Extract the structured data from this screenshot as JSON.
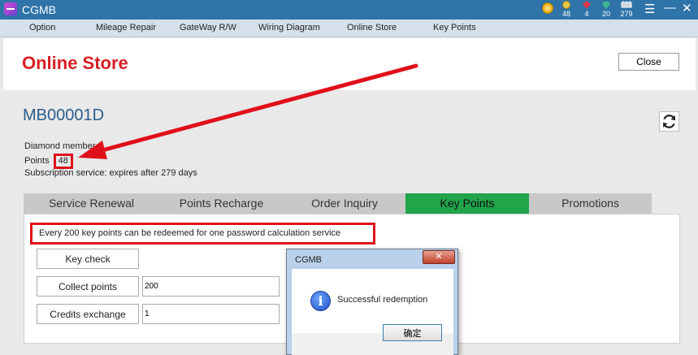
{
  "app": {
    "title": "CGMB"
  },
  "titlebar": {
    "stats": [
      {
        "icon": "gold-coin-icon",
        "color": "#f2b51a",
        "value": ""
      },
      {
        "icon": "coin-icon",
        "color": "#e8c64a",
        "value": "48"
      },
      {
        "icon": "ruby-icon",
        "color": "#e0334a",
        "value": "4"
      },
      {
        "icon": "emerald-icon",
        "color": "#3fb48a",
        "value": "20"
      },
      {
        "icon": "chip-icon",
        "color": "#cfd6de",
        "value": "279"
      }
    ]
  },
  "menu": {
    "items": [
      "Option",
      "Mileage Repair",
      "GateWay R/W",
      "Wiring Diagram",
      "Online Store",
      "Key Points"
    ]
  },
  "header": {
    "title": "Online Store",
    "close_label": "Close"
  },
  "account": {
    "id": "MB00001D",
    "member": "Diamond member",
    "points_label": "Points",
    "points": "48",
    "subscription": "Subscription service: expires after 279 days"
  },
  "tabs": [
    {
      "label": "Service Renewal",
      "active": false
    },
    {
      "label": "Points Recharge",
      "active": false
    },
    {
      "label": "Order Inquiry",
      "active": false
    },
    {
      "label": "Key Points",
      "active": true
    },
    {
      "label": "Promotions",
      "active": false
    }
  ],
  "keypoints": {
    "notice": "Every 200 key points can be redeemed for one password calculation service",
    "key_check": "Key check",
    "collect_points": "Collect points",
    "collect_value": "200",
    "credits_exchange": "Credits exchange",
    "credits_value": "1"
  },
  "dialog": {
    "title": "CGMB",
    "message": "Successful redemption",
    "ok_label": "确定"
  },
  "colors": {
    "accent_red": "#d81e24",
    "titlebar": "#2e74a8",
    "active_tab": "#21a44a"
  }
}
